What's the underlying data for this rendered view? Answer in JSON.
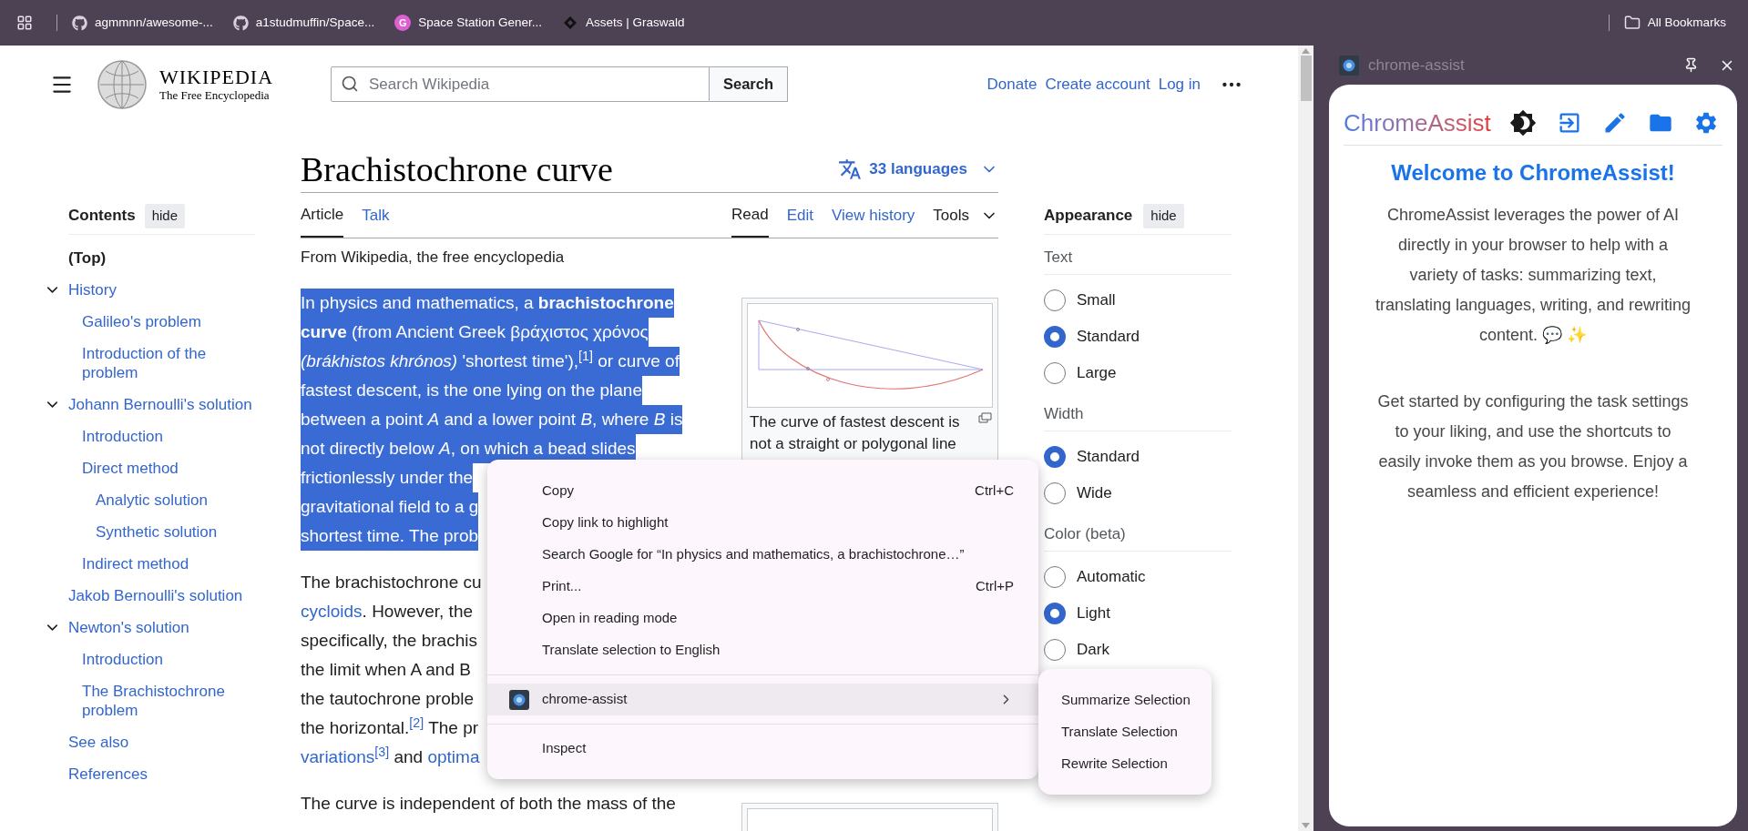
{
  "bookmarks_bar": {
    "items": [
      {
        "label": "agmmnn/awesome-...",
        "kind": "github"
      },
      {
        "label": "a1studmuffin/Space...",
        "kind": "github"
      },
      {
        "label": "Space Station Gener...",
        "kind": "letter",
        "letter": "G"
      },
      {
        "label": "Assets | Graswald",
        "kind": "shape"
      }
    ],
    "all_bookmarks": "All Bookmarks"
  },
  "wiki_header": {
    "wordmark": "WIKIPEDIA",
    "tagline": "The Free Encyclopedia",
    "search": {
      "placeholder": "Search Wikipedia",
      "button": "Search"
    },
    "links": [
      "Donate",
      "Create account",
      "Log in"
    ]
  },
  "contents": {
    "title": "Contents",
    "hide": "hide",
    "items": [
      {
        "label": "(Top)",
        "selected": true
      },
      {
        "label": "History",
        "selected": false,
        "expanded": true,
        "children": [
          {
            "label": "Galileo's problem",
            "selected": false
          },
          {
            "label": "Introduction of the problem",
            "selected": false
          }
        ]
      },
      {
        "label": "Johann Bernoulli's solution",
        "selected": false,
        "expanded": true,
        "children": [
          {
            "label": "Introduction",
            "selected": false
          },
          {
            "label": "Direct method",
            "selected": false,
            "children": [
              {
                "label": "Analytic solution",
                "selected": false
              },
              {
                "label": "Synthetic solution",
                "selected": false
              }
            ]
          },
          {
            "label": "Indirect method",
            "selected": false
          }
        ]
      },
      {
        "label": "Jakob Bernoulli's solution",
        "selected": false
      },
      {
        "label": "Newton's solution",
        "selected": false,
        "expanded": true,
        "children": [
          {
            "label": "Introduction",
            "selected": false
          },
          {
            "label": "The Brachistochrone problem",
            "selected": false
          }
        ]
      },
      {
        "label": "See also",
        "selected": false
      },
      {
        "label": "References",
        "selected": false
      }
    ]
  },
  "article": {
    "title": "Brachistochrone curve",
    "languages": "33 languages",
    "tabs": [
      {
        "label": "Article",
        "selected": true
      },
      {
        "label": "Talk",
        "selected": false
      }
    ],
    "views": [
      {
        "label": "Read",
        "kind": "tab",
        "selected": true
      },
      {
        "label": "Edit",
        "kind": "tab",
        "selected": false
      },
      {
        "label": "View history",
        "kind": "tab",
        "selected": false
      },
      {
        "label": "Tools",
        "kind": "menu",
        "selected": false
      }
    ],
    "tagline": "From Wikipedia, the free encyclopedia",
    "paragraphs": [
      {
        "selected": true,
        "lines": [
          [
            {
              "text": "In physics and mathematics, a **brachistochrone**"
            }
          ],
          [
            {
              "text": "**curve** (from Ancient Greek βράχιστος χρόνος"
            }
          ],
          [
            {
              "text": "*(brákhistos khrónos)* 'shortest time'),"
            },
            {
              "text": "$^{[1]}$",
              "link": true
            },
            {
              "text": " or curve of"
            }
          ],
          [
            {
              "text": "fastest descent, is the one lying on the plane"
            }
          ],
          [
            {
              "text": "between a point *A* and a lower point *B*, where *B* is"
            }
          ],
          [
            {
              "text": "not directly below *A*, on which a bead slides"
            }
          ],
          [
            {
              "text": "frictionlessly under the"
            }
          ],
          [
            {
              "text": "gravitational field to a g"
            }
          ],
          [
            {
              "text": "shortest time. The prob"
            }
          ]
        ]
      },
      {
        "selected": false,
        "lines": [
          [
            {
              "text": "The brachistochrone cu"
            }
          ],
          [
            {
              "text": "cycloids",
              "link": true
            },
            {
              "text": ". However, the"
            }
          ],
          [
            {
              "text": "specifically, the brachis"
            }
          ],
          [
            {
              "text": "the limit when A and B"
            }
          ],
          [
            {
              "text": "the tautochrone proble"
            }
          ],
          [
            {
              "text": "the horizontal."
            },
            {
              "text": "$^{[2]}$",
              "link": true
            },
            {
              "text": " The pr"
            }
          ],
          [
            {
              "text": "variations$^{[3]}$",
              "link": true
            },
            {
              "text": " and "
            },
            {
              "text": "optima",
              "link": true
            }
          ]
        ]
      },
      {
        "selected": false,
        "lines": [
          [
            {
              "text": "The curve is independent of both the mass of the"
            }
          ]
        ]
      }
    ],
    "figure": {
      "caption_lines": [
        "The curve of fastest descent is",
        "not a straight or polygonal line"
      ]
    }
  },
  "appearance": {
    "title": "Appearance",
    "hide": "hide",
    "groups": [
      {
        "label": "Text",
        "options": [
          {
            "label": "Small",
            "selected": false
          },
          {
            "label": "Standard",
            "selected": true
          },
          {
            "label": "Large",
            "selected": false
          }
        ]
      },
      {
        "label": "Width",
        "options": [
          {
            "label": "Standard",
            "selected": true
          },
          {
            "label": "Wide",
            "selected": false
          }
        ]
      },
      {
        "label": "Color (beta)",
        "options": [
          {
            "label": "Automatic",
            "selected": false
          },
          {
            "label": "Light",
            "selected": true
          },
          {
            "label": "Dark",
            "selected": false
          }
        ]
      }
    ]
  },
  "context_menu": {
    "items": [
      {
        "kind": "item",
        "label": "Copy",
        "shortcut": "Ctrl+C",
        "highlighted": false
      },
      {
        "kind": "item",
        "label": "Copy link to highlight",
        "highlighted": false
      },
      {
        "kind": "item",
        "label": "Search Google for “In physics and mathematics, a brachistochrone…”",
        "highlighted": false
      },
      {
        "kind": "item",
        "label": "Print...",
        "shortcut": "Ctrl+P",
        "highlighted": false
      },
      {
        "kind": "item",
        "label": "Open in reading mode",
        "highlighted": false
      },
      {
        "kind": "item",
        "label": "Translate selection to English",
        "highlighted": false
      },
      {
        "kind": "separator"
      },
      {
        "kind": "submenu",
        "label": "chrome-assist",
        "highlighted": true
      },
      {
        "kind": "separator"
      },
      {
        "kind": "item",
        "label": "Inspect",
        "highlighted": false
      }
    ],
    "submenu": [
      "Summarize Selection",
      "Translate Selection",
      "Rewrite Selection"
    ]
  },
  "side_panel": {
    "title": "chrome-assist",
    "brand": "ChromeAssist",
    "heading": "Welcome to ChromeAssist!",
    "paragraphs": [
      "ChromeAssist leverages the power of AI directly in your browser to help with a variety of tasks: summarizing text, translating languages, writing, and rewriting content. 💬 ✨",
      "Get started by configuring the task settings to your liking, and use the shortcuts to easily invoke them as you browse. Enjoy a seamless and efficient experience!"
    ]
  }
}
